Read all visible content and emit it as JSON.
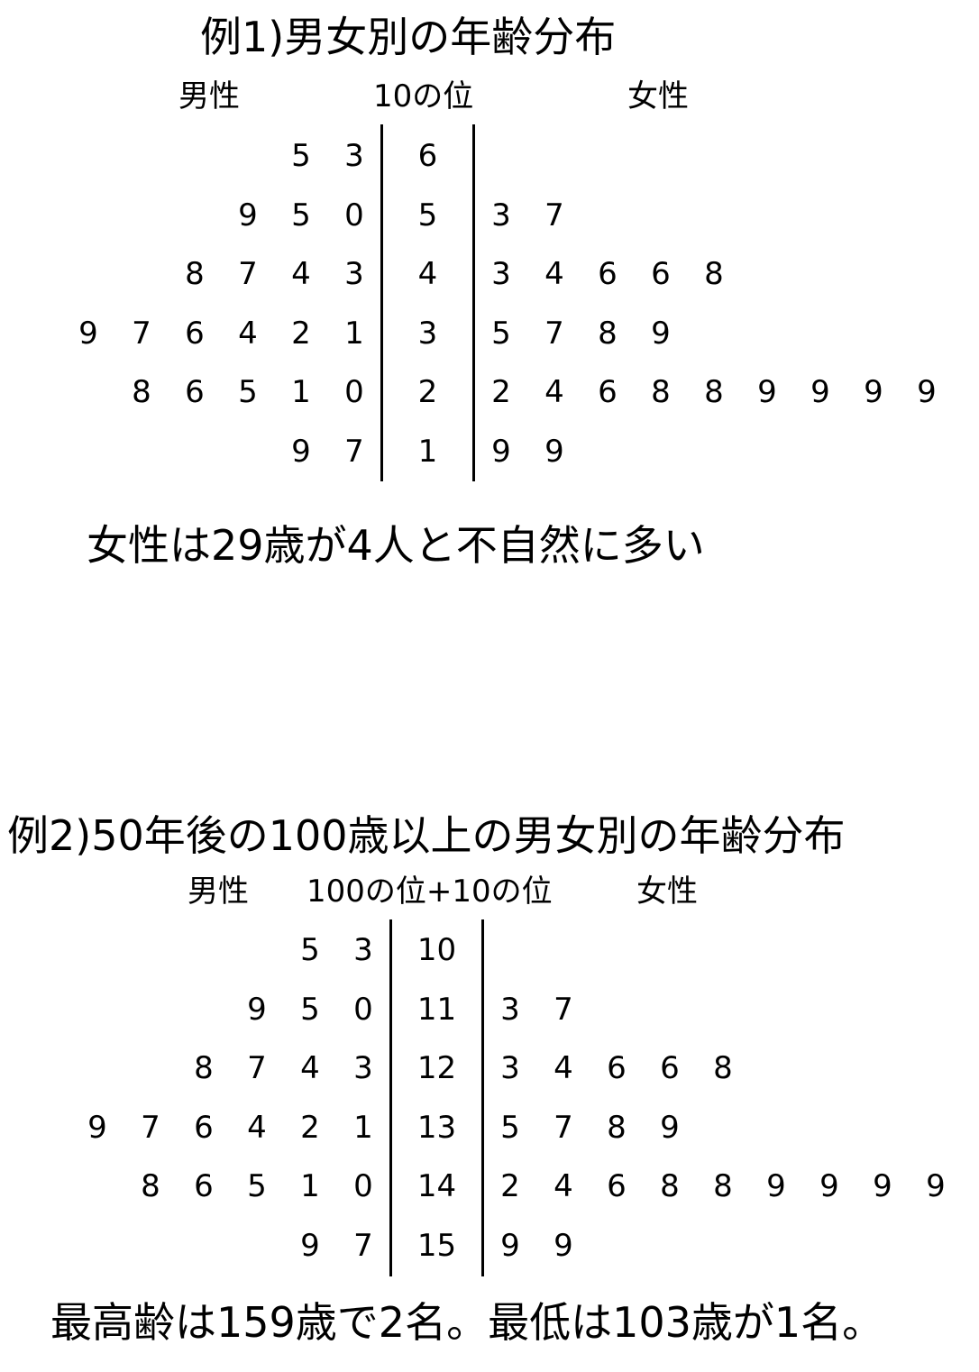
{
  "chart_data": [
    {
      "type": "stem-and-leaf",
      "title": "例1)男女別の年齢分布",
      "left_label": "男性",
      "stem_label": "10の位",
      "right_label": "女性",
      "rows": [
        {
          "stem": "6",
          "left": [
            "5",
            "3"
          ],
          "right": []
        },
        {
          "stem": "5",
          "left": [
            "9",
            "5",
            "0"
          ],
          "right": [
            "3",
            "7"
          ]
        },
        {
          "stem": "4",
          "left": [
            "8",
            "7",
            "4",
            "3"
          ],
          "right": [
            "3",
            "4",
            "6",
            "6",
            "8"
          ]
        },
        {
          "stem": "3",
          "left": [
            "9",
            "7",
            "6",
            "4",
            "2",
            "1"
          ],
          "right": [
            "5",
            "7",
            "8",
            "9"
          ]
        },
        {
          "stem": "2",
          "left": [
            "8",
            "6",
            "5",
            "1",
            "0"
          ],
          "right": [
            "2",
            "4",
            "6",
            "8",
            "8",
            "9",
            "9",
            "9",
            "9"
          ]
        },
        {
          "stem": "1",
          "left": [
            "9",
            "7"
          ],
          "right": [
            "9",
            "9"
          ]
        }
      ],
      "note": "女性は29歳が4人と不自然に多い"
    },
    {
      "type": "stem-and-leaf",
      "title": "例2)50年後の100歳以上の男女別の年齢分布",
      "left_label": "男性",
      "stem_label": "100の位+10の位",
      "right_label": "女性",
      "rows": [
        {
          "stem": "10",
          "left": [
            "5",
            "3"
          ],
          "right": []
        },
        {
          "stem": "11",
          "left": [
            "9",
            "5",
            "0"
          ],
          "right": [
            "3",
            "7"
          ]
        },
        {
          "stem": "12",
          "left": [
            "8",
            "7",
            "4",
            "3"
          ],
          "right": [
            "3",
            "4",
            "6",
            "6",
            "8"
          ]
        },
        {
          "stem": "13",
          "left": [
            "9",
            "7",
            "6",
            "4",
            "2",
            "1"
          ],
          "right": [
            "5",
            "7",
            "8",
            "9"
          ]
        },
        {
          "stem": "14",
          "left": [
            "8",
            "6",
            "5",
            "1",
            "0"
          ],
          "right": [
            "2",
            "4",
            "6",
            "8",
            "8",
            "9",
            "9",
            "9",
            "9"
          ]
        },
        {
          "stem": "15",
          "left": [
            "9",
            "7"
          ],
          "right": [
            "9",
            "9"
          ]
        }
      ],
      "note": "最高齢は159歳で2名。最低は103歳が1名。"
    }
  ]
}
